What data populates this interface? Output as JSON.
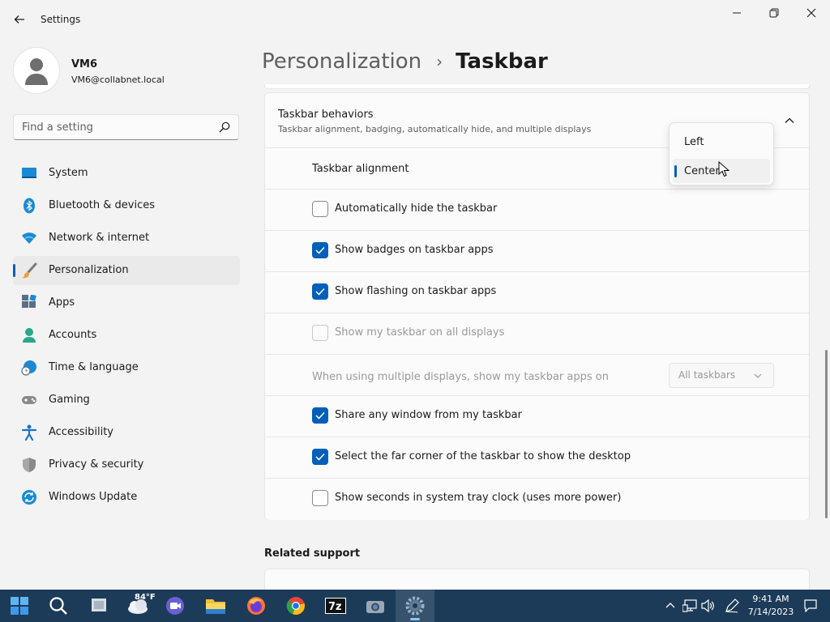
{
  "window": {
    "title": "Settings"
  },
  "profile": {
    "name": "VM6",
    "email": "VM6@collabnet.local"
  },
  "search": {
    "placeholder": "Find a setting"
  },
  "sidebar": {
    "items": [
      {
        "label": "System",
        "icon": "system-icon"
      },
      {
        "label": "Bluetooth & devices",
        "icon": "bluetooth-icon"
      },
      {
        "label": "Network & internet",
        "icon": "wifi-icon"
      },
      {
        "label": "Personalization",
        "icon": "brush-icon",
        "selected": true
      },
      {
        "label": "Apps",
        "icon": "apps-icon"
      },
      {
        "label": "Accounts",
        "icon": "accounts-icon"
      },
      {
        "label": "Time & language",
        "icon": "clock-globe-icon"
      },
      {
        "label": "Gaming",
        "icon": "gamepad-icon"
      },
      {
        "label": "Accessibility",
        "icon": "accessibility-icon"
      },
      {
        "label": "Privacy & security",
        "icon": "shield-icon"
      },
      {
        "label": "Windows Update",
        "icon": "update-icon"
      }
    ]
  },
  "header": {
    "parent": "Personalization",
    "separator": "›",
    "current": "Taskbar"
  },
  "behaviors": {
    "title": "Taskbar behaviors",
    "subtitle": "Taskbar alignment, badging, automatically hide, and multiple displays",
    "alignment_label": "Taskbar alignment",
    "alignment_options": [
      "Left",
      "Center"
    ],
    "alignment_selected": "Center",
    "options": [
      {
        "label": "Automatically hide the taskbar",
        "checked": false,
        "disabled": false
      },
      {
        "label": "Show badges on taskbar apps",
        "checked": true,
        "disabled": false
      },
      {
        "label": "Show flashing on taskbar apps",
        "checked": true,
        "disabled": false
      },
      {
        "label": "Show my taskbar on all displays",
        "checked": false,
        "disabled": true
      }
    ],
    "multi_display_label": "When using multiple displays, show my taskbar apps on",
    "multi_display_value": "All taskbars",
    "options2": [
      {
        "label": "Share any window from my taskbar",
        "checked": true,
        "disabled": false
      },
      {
        "label": "Select the far corner of the taskbar to show the desktop",
        "checked": true,
        "disabled": false
      },
      {
        "label": "Show seconds in system tray clock (uses more power)",
        "checked": false,
        "disabled": false
      }
    ]
  },
  "related": {
    "title": "Related support"
  },
  "taskbar": {
    "weather_temp": "84°F",
    "time": "9:41 AM",
    "date": "7/14/2023",
    "apps": [
      "start-icon",
      "search-icon",
      "task-view-icon",
      "weather-icon",
      "meet-icon",
      "file-explorer-icon",
      "firefox-icon",
      "chrome-icon",
      "7zip-icon",
      "camera-icon",
      "settings-gear-icon"
    ],
    "accent": "#005fb8"
  }
}
